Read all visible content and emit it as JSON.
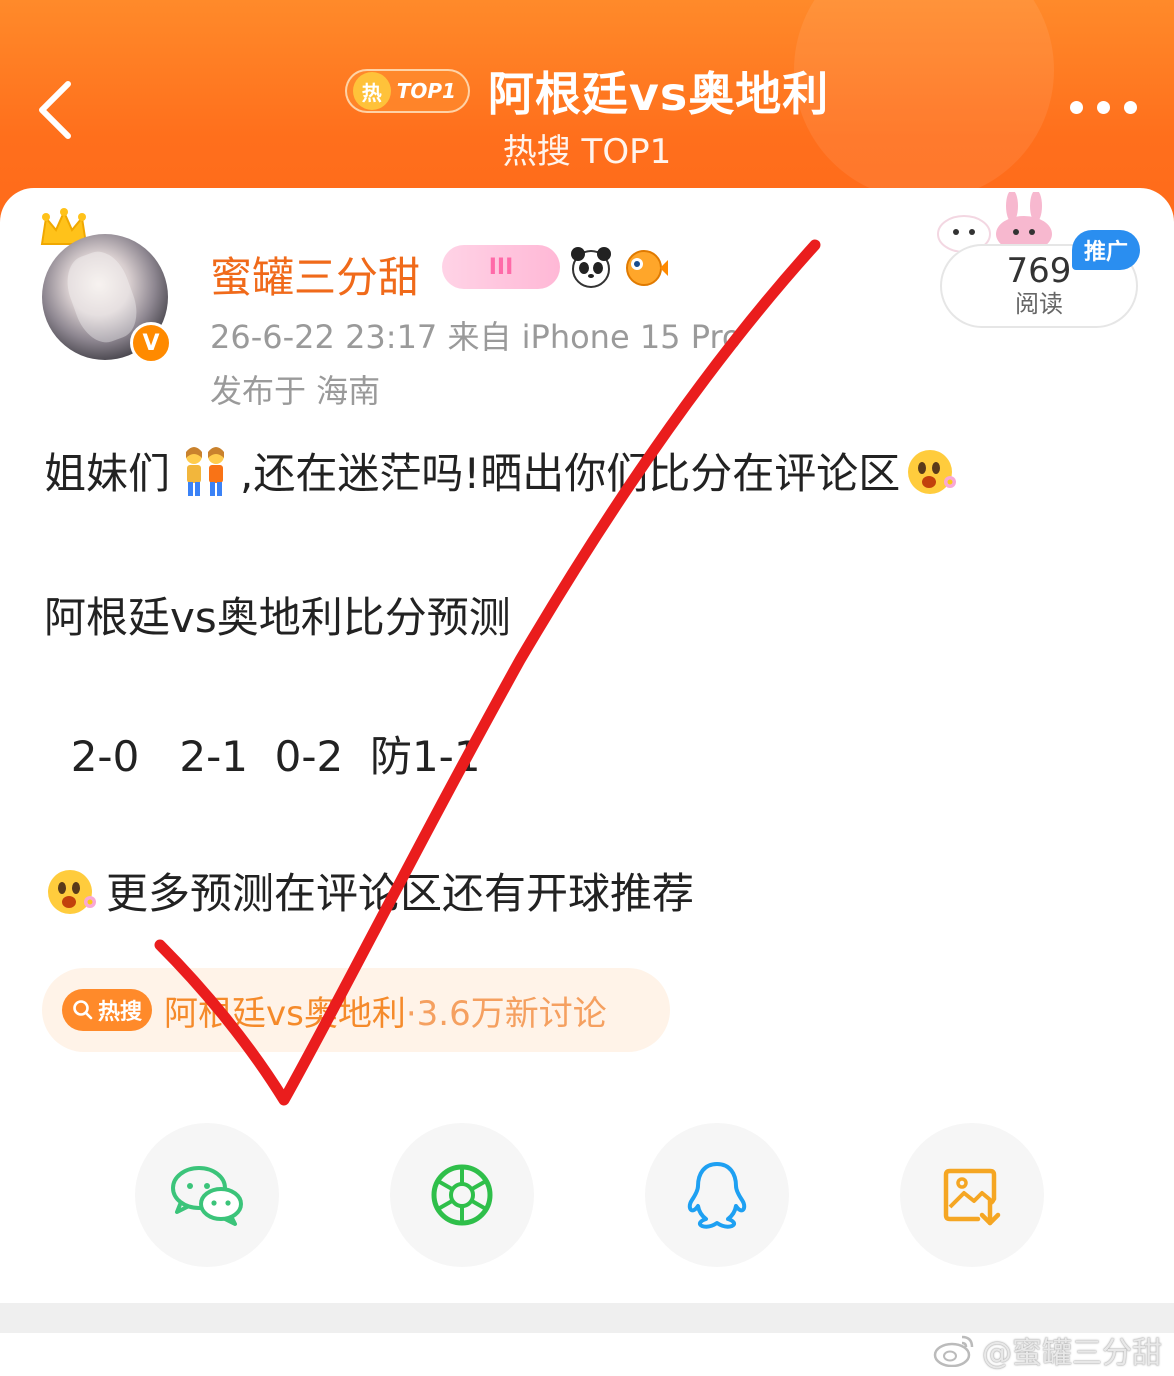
{
  "header": {
    "badge_label": "TOP1",
    "badge_icon_text": "热",
    "title": "阿根廷vs奥地利",
    "subtitle": "热搜 TOP1",
    "background_color": "#ff6f1c"
  },
  "post": {
    "author": {
      "name": "蜜罐三分甜",
      "verified_badge": "V",
      "level_badge": "III"
    },
    "meta_time_source": "26-6-22 23:17  来自 iPhone 15 Pro",
    "meta_location": "发布于 海南",
    "reads": {
      "count": "769",
      "label": "阅读",
      "ad_tag": "推广"
    },
    "lines": [
      {
        "before": "姐妹们",
        "after": ",还在迷茫吗!晒出你们比分在评论区"
      },
      {
        "text": "阿根廷vs奥地利比分预测"
      },
      {
        "text": "  2-0   2-1  0-2  防1-1"
      },
      {
        "text": "更多预测在评论区还有开球推荐"
      }
    ],
    "hot_tag": {
      "chip_label": "热搜",
      "topic": "阿根廷vs奥地利",
      "stats": "·3.6万新讨论"
    }
  },
  "share": [
    {
      "icon": "wechat-icon",
      "color": "#3bc47a"
    },
    {
      "icon": "moments-icon",
      "color": "#2fbf4a"
    },
    {
      "icon": "qq-icon",
      "color": "#1ea0f2"
    },
    {
      "icon": "save-image-icon",
      "color": "#f5a623"
    }
  ],
  "watermark": {
    "text": "@蜜罐三分甜"
  },
  "overlay": {
    "check_color": "#ea1d1d"
  }
}
